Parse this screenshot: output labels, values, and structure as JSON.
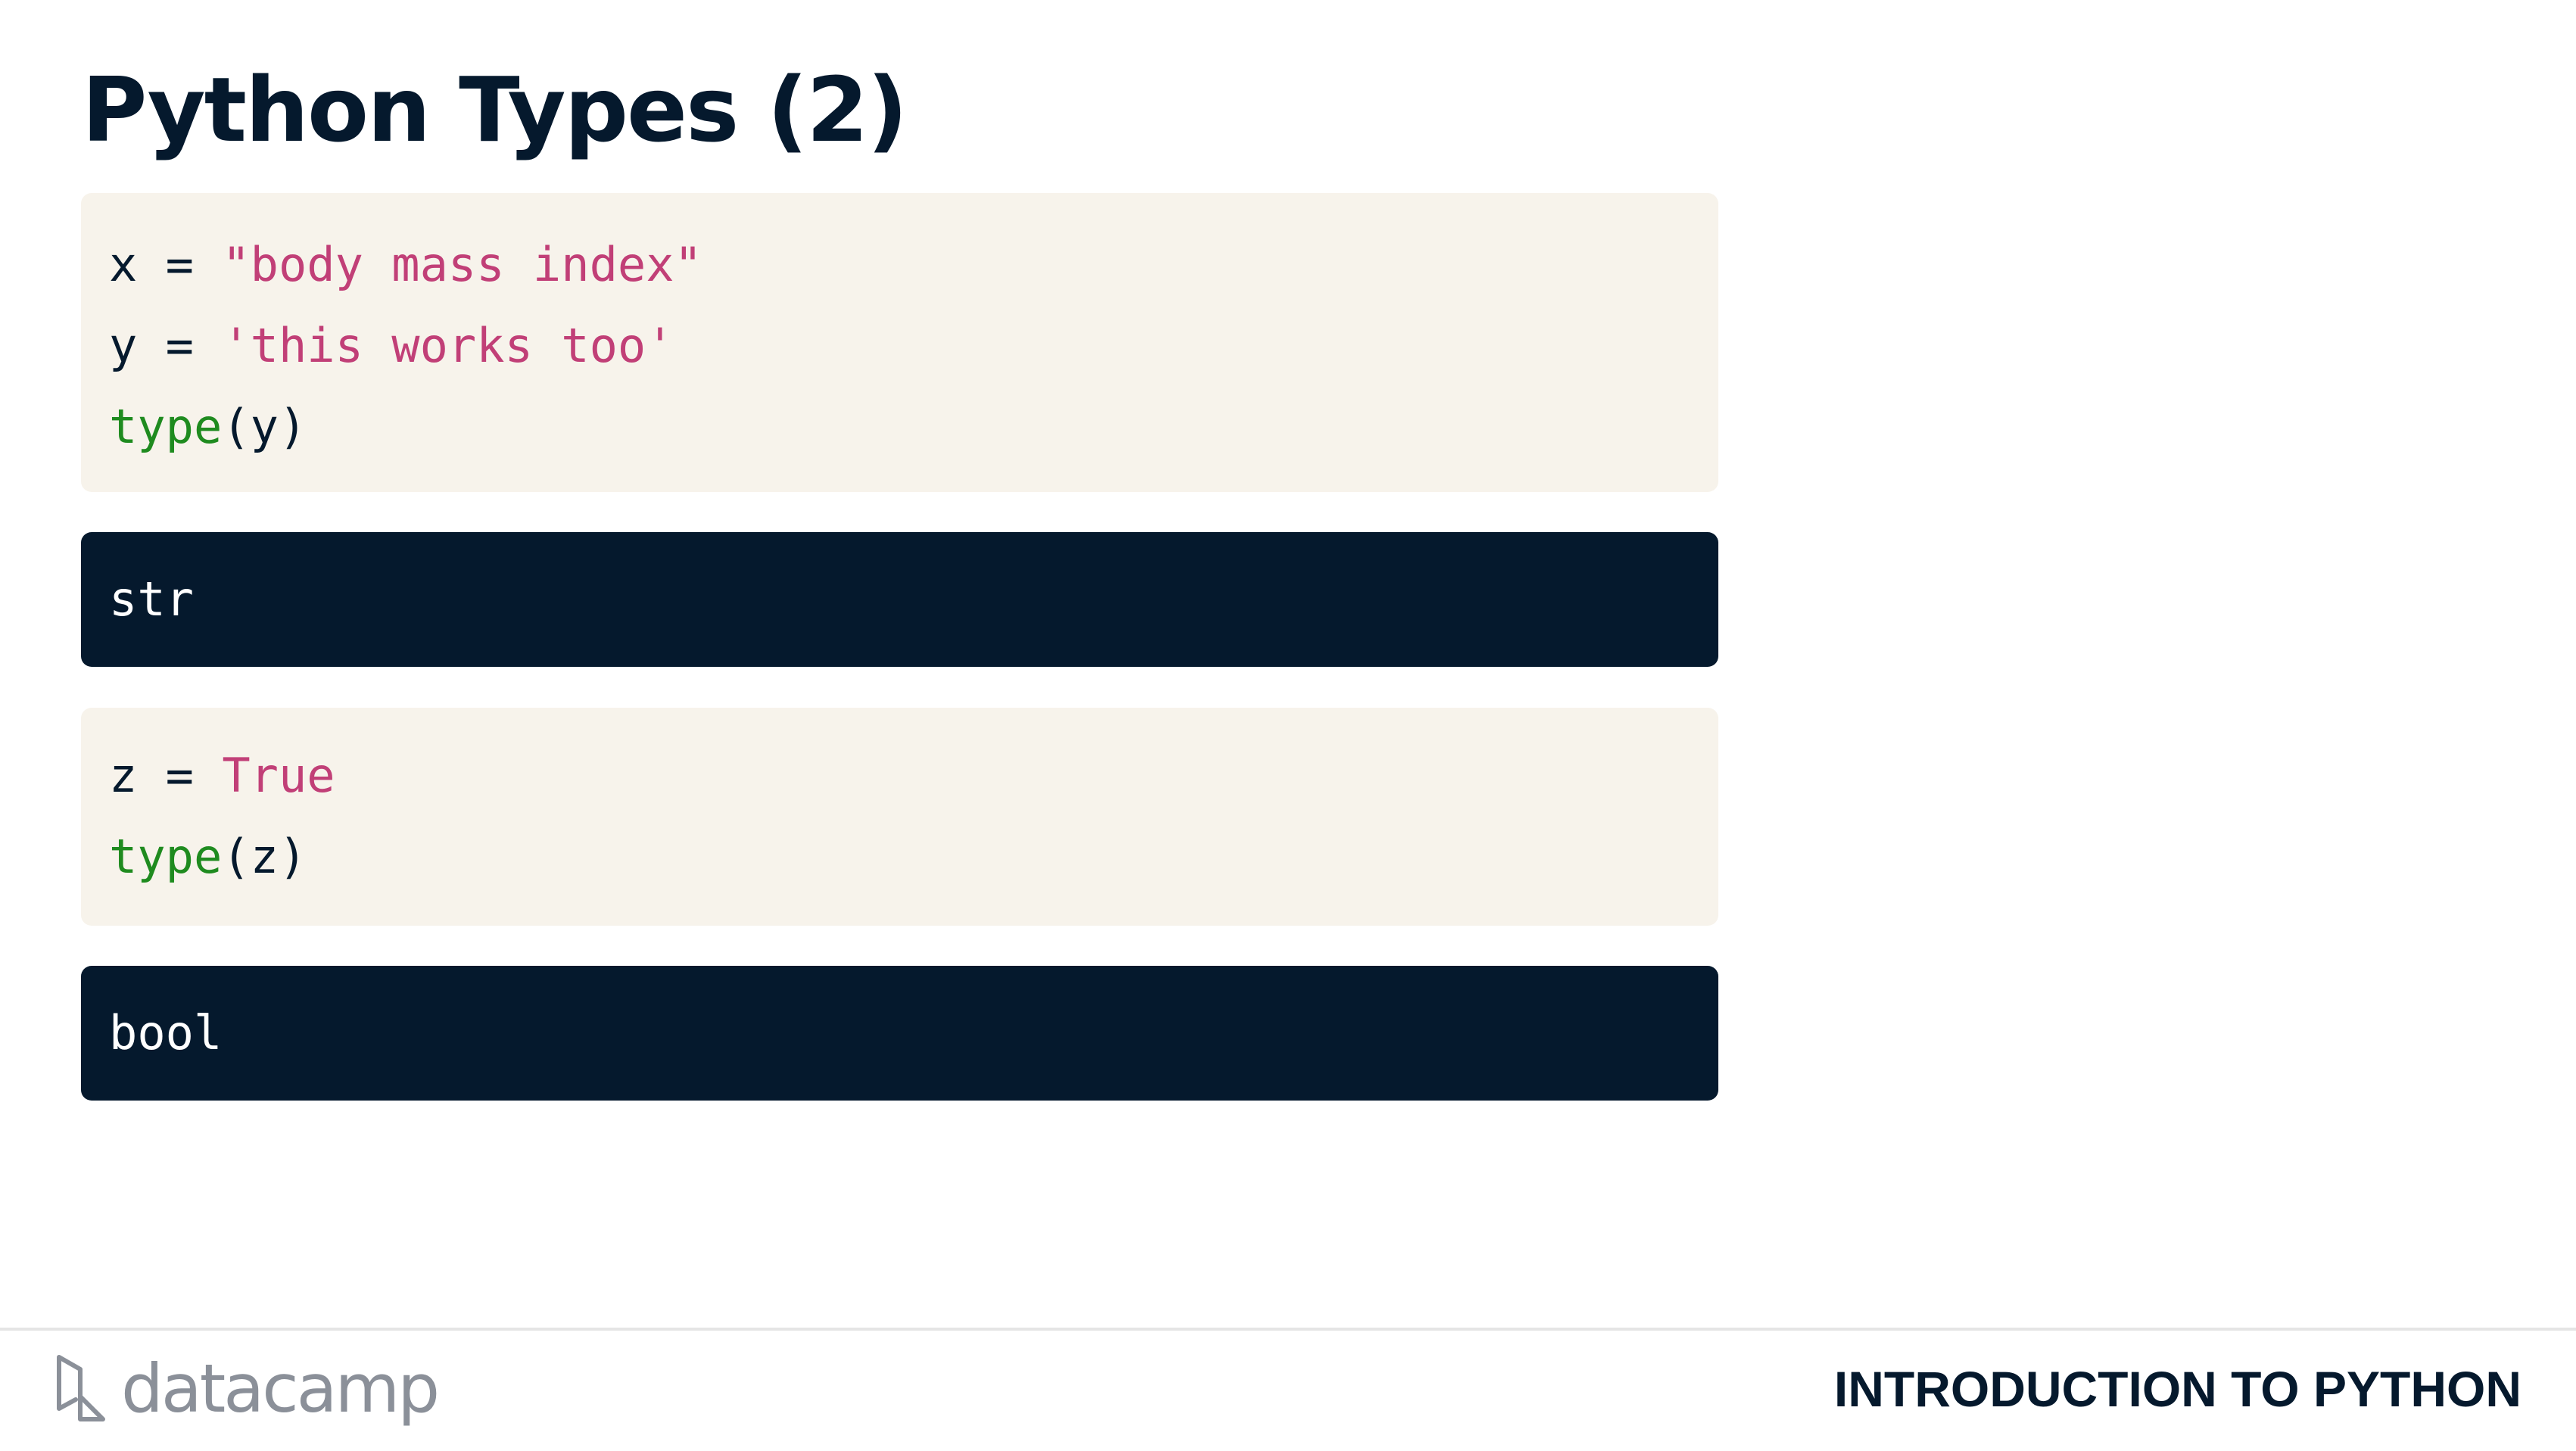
{
  "slide": {
    "title": "Python Types (2)"
  },
  "code_blocks": [
    {
      "lines": [
        {
          "parts": [
            "x = ",
            "\"body mass index\""
          ]
        },
        {
          "parts": [
            "y = ",
            "'this works too'"
          ]
        },
        {
          "parts": [
            "type",
            "(y)"
          ]
        }
      ]
    },
    {
      "lines": [
        {
          "parts": [
            "z = ",
            "True"
          ]
        },
        {
          "parts": [
            "type",
            "(z)"
          ]
        }
      ]
    }
  ],
  "outputs": [
    {
      "text": "str"
    },
    {
      "text": "bool"
    }
  ],
  "footer": {
    "logo_text": "datacamp",
    "logo_icon": "datacamp-logo-icon",
    "course_title": "INTRODUCTION TO PYTHON"
  },
  "colors": {
    "title": "#05192d",
    "code_background": "#f7f3eb",
    "output_background": "#05192d",
    "string_literal": "#c13f77",
    "builtin_function": "#1f8b1f",
    "logo_gray": "#8b9099"
  }
}
